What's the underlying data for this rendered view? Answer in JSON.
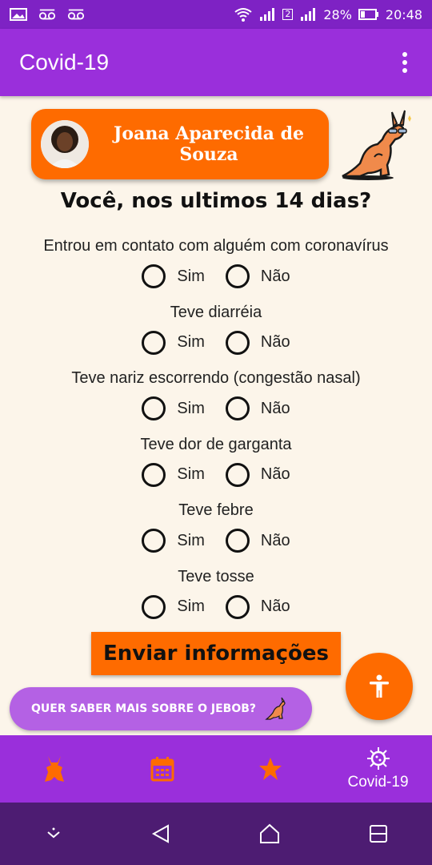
{
  "status_bar": {
    "battery": "28%",
    "time": "20:48",
    "sim_label": "2",
    "icons": [
      "image-icon",
      "voicemail-icon",
      "voicemail-icon",
      "wifi-icon",
      "signal-icon",
      "signal-icon",
      "battery-icon"
    ]
  },
  "app_bar": {
    "title": "Covid-19",
    "menu_icon": "more-vert-icon"
  },
  "profile": {
    "name": "Joana Aparecida de Souza"
  },
  "heading": "Você, nos ultimos 14 dias?",
  "questions": [
    {
      "text": "Entrou em contato com alguém com coronavírus",
      "yes": "Sim",
      "no": "Não"
    },
    {
      "text": "Teve diarréia",
      "yes": "Sim",
      "no": "Não"
    },
    {
      "text": "Teve nariz escorrendo (congestão nasal)",
      "yes": "Sim",
      "no": "Não"
    },
    {
      "text": "Teve dor de garganta",
      "yes": "Sim",
      "no": "Não"
    },
    {
      "text": "Teve febre",
      "yes": "Sim",
      "no": "Não"
    },
    {
      "text": "Teve tosse",
      "yes": "Sim",
      "no": "Não"
    }
  ],
  "send_button": "Enviar informações",
  "more_button": "QUER SABER MAIS SOBRE O JEBOB?",
  "bottom_nav": {
    "items": [
      {
        "icon": "rabbit-icon",
        "label": ""
      },
      {
        "icon": "calendar-icon",
        "label": ""
      },
      {
        "icon": "star-icon",
        "label": ""
      },
      {
        "icon": "virus-icon",
        "label": "Covid-19"
      }
    ]
  },
  "colors": {
    "purple": "#9a2fdb",
    "orange": "#fe6b00",
    "background": "#fcf5ea",
    "dark_purple": "#4d1c72"
  }
}
